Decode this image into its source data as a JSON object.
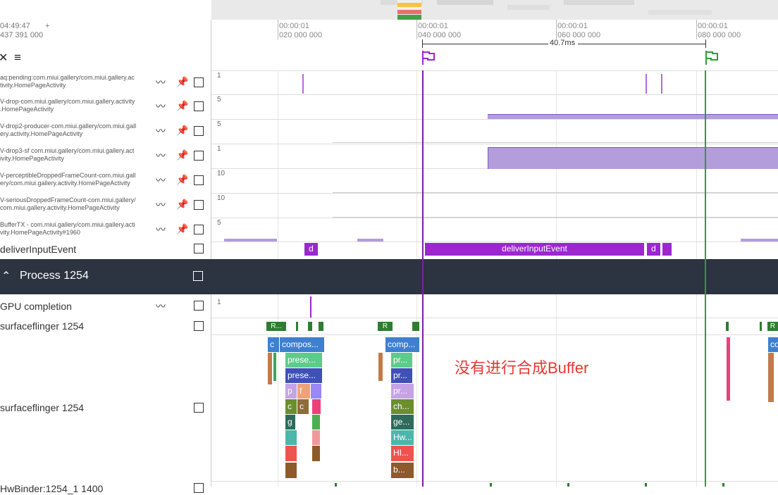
{
  "header": {
    "timestamp_line1": "04:49:47",
    "timestamp_plus": "+",
    "timestamp_line2": "437 391 000",
    "ruler_ticks": [
      {
        "t1": "00:00:01",
        "t2": "020 000 000"
      },
      {
        "t1": "00:00:01",
        "t2": "040 000 000"
      },
      {
        "t1": "00:00:01",
        "t2": "060 000 000"
      },
      {
        "t1": "00:00:01",
        "t2": "080 000 000"
      }
    ],
    "measure_label": "40.7ms"
  },
  "tracks": [
    {
      "name": "aq:pending:com.miui.gallery/com.miui.gallery.activity.HomePageActivity",
      "name_l1": "aq:pending:com.miui.gallery/com.miui.gallery.ac",
      "name_l2": "tivity.HomePageActivity",
      "scale": "1"
    },
    {
      "name_l1": "V-drop-com.miui.gallery/com.miui.gallery.activity",
      "name_l2": ".HomePageActivity",
      "scale": "5"
    },
    {
      "name_l1": "V-drop2-producer-com.miui.gallery/com.miui.gall",
      "name_l2": "ery.activity.HomePageActivity",
      "scale": "5"
    },
    {
      "name_l1": "V-drop3-sf com.miui.gallery/com.miui.gallery.act",
      "name_l2": "ivity.HomePageActivity",
      "scale": "1"
    },
    {
      "name_l1": "V-perceptibleDroppedFrameCount-com.miui.gall",
      "name_l2": "ery/com.miui.gallery.activity.HomePageActivity",
      "scale": "10"
    },
    {
      "name_l1": "V-seriousDroppedFrameCount-com.miui.gallery/",
      "name_l2": "com.miui.gallery.activity.HomePageActivity",
      "scale": "10"
    },
    {
      "name_l1": "BufferTX - com.miui.gallery/com.miui.gallery.acti",
      "name_l2": "vity.HomePageActivity#1960",
      "scale": "5"
    }
  ],
  "deliver": {
    "name": "deliverInputEvent",
    "slices": [
      "d",
      "deliverInputEvent",
      "d"
    ]
  },
  "process": {
    "title": "Process 1254"
  },
  "gpu": {
    "name": "GPU completion",
    "scale": "1"
  },
  "sf_small": {
    "name": "surfaceflinger 1254",
    "labels": [
      "R...",
      "R",
      "R"
    ]
  },
  "sf_big": {
    "name": "surfaceflinger 1254",
    "g1": [
      "c",
      "compos...",
      "prese...",
      "prese...",
      "p",
      "f",
      "c",
      "c",
      "g"
    ],
    "g2": [
      "comp...",
      "pr...",
      "pr...",
      "pr...",
      "ch...",
      "ge...",
      "Hw...",
      "HI...",
      "b..."
    ],
    "g3": [
      "co"
    ]
  },
  "annotation": "没有进行合成Buffer",
  "bottom": {
    "name": "HwBinder:1254_1 1400"
  },
  "colors": {
    "purple": "#7b1fa2",
    "green": "#2e9d3a",
    "slice_purple": "#9c27d0",
    "counter_fill": "#b39ddb",
    "process_bg": "#2b3440",
    "annotation_red": "#e53935"
  }
}
